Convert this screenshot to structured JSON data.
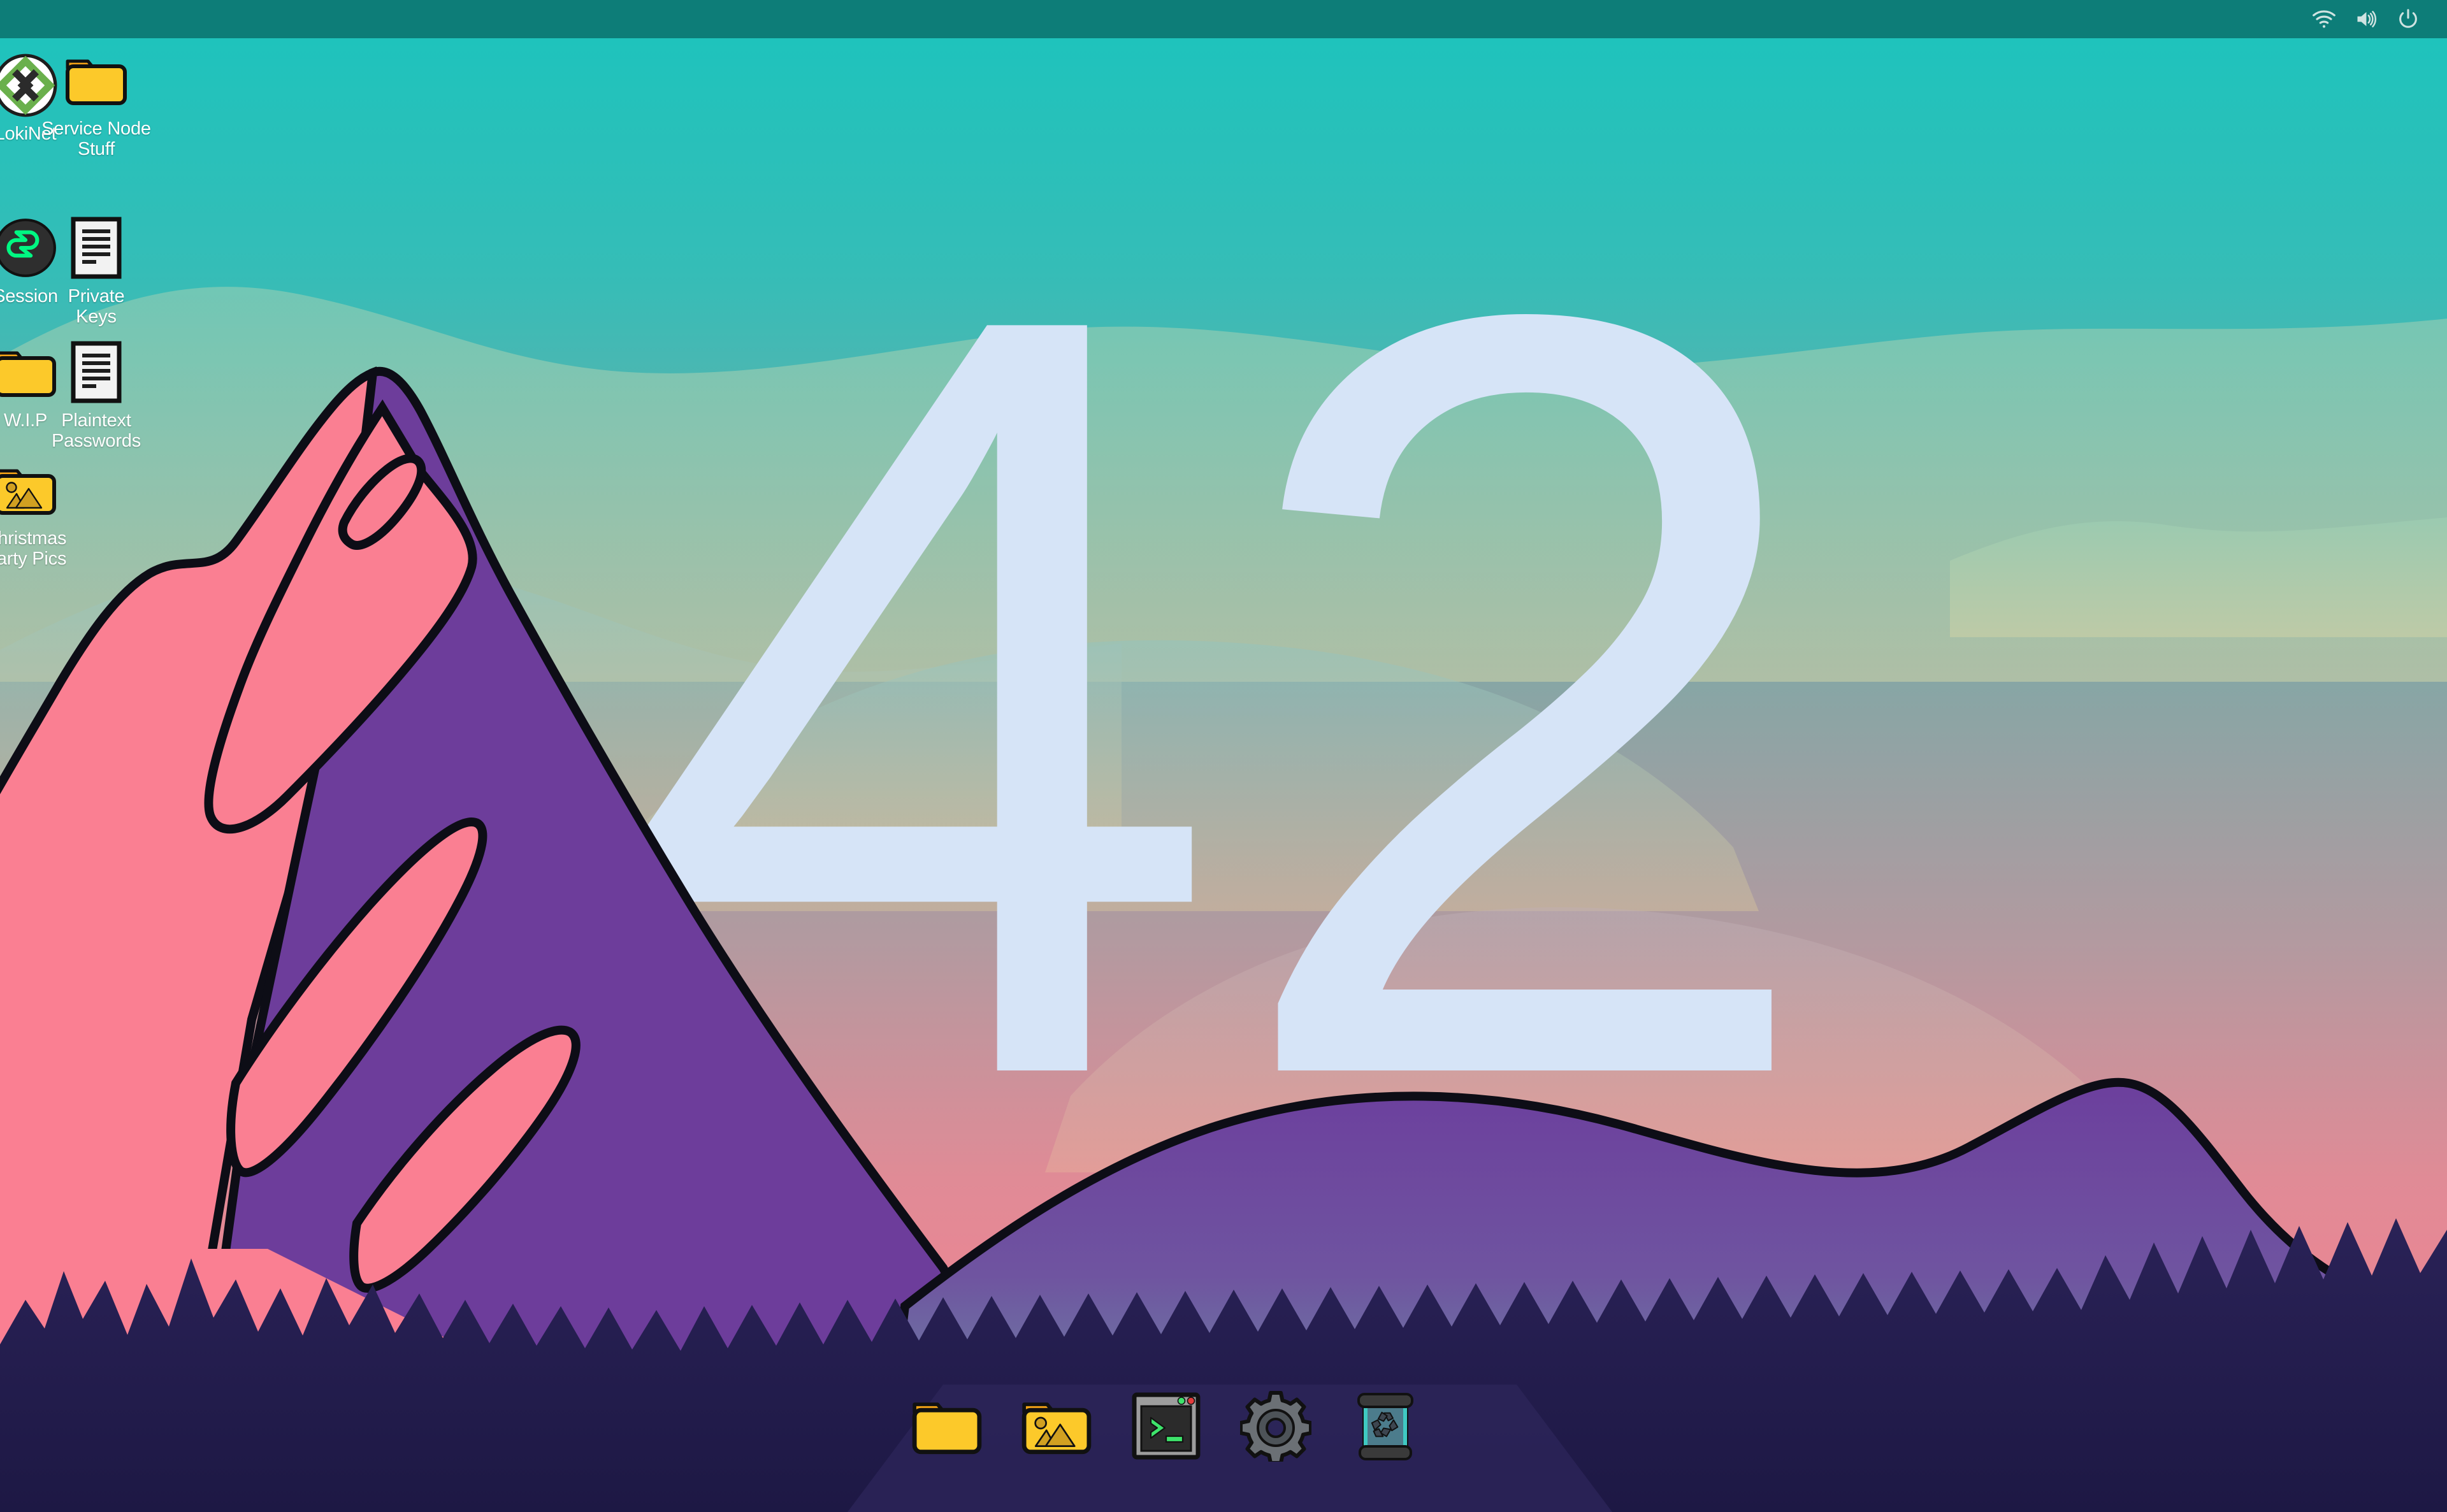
{
  "desktop": {
    "wallpaper": {
      "big_text": "42",
      "big_text_color": "#d6e4f7",
      "sky_top_color": "#1bc4bd",
      "sky_mid_color": "#8fa5a3",
      "sky_bottom_color": "#f07f8e",
      "mountain_pink_color": "#fa7f92",
      "mountain_purple_color": "#6e3e9c",
      "forest_color": "#231c4f",
      "outline_color": "#000000"
    },
    "icons": [
      {
        "label": "LokiNet",
        "icon": "lokinet-app-icon",
        "col": 0,
        "row": 0
      },
      {
        "label": "Service Node\nStuff",
        "icon": "folder-icon",
        "col": 1,
        "row": 0
      },
      {
        "label": "Session",
        "icon": "session-app-icon",
        "col": 0,
        "row": 1
      },
      {
        "label": "Private\nKeys",
        "icon": "text-document-icon",
        "col": 1,
        "row": 1
      },
      {
        "label": "W.I.P",
        "icon": "folder-icon",
        "col": 0,
        "row": 2
      },
      {
        "label": "Plaintext\nPasswords",
        "icon": "text-document-icon",
        "col": 1,
        "row": 2
      },
      {
        "label": "Christmas\nParty Pics",
        "icon": "folder-pictures-icon",
        "col": 0,
        "row": 3
      }
    ]
  },
  "topbar": {
    "background_color": "#0d7d78",
    "tray": [
      {
        "name": "wifi-icon",
        "title": "Network"
      },
      {
        "name": "volume-icon",
        "title": "Volume"
      },
      {
        "name": "power-icon",
        "title": "Power"
      }
    ]
  },
  "dock": {
    "background_color": "#2b2558",
    "items": [
      {
        "label": "Files",
        "icon": "folder-icon"
      },
      {
        "label": "Pictures",
        "icon": "folder-pictures-icon"
      },
      {
        "label": "Terminal",
        "icon": "terminal-icon"
      },
      {
        "label": "Settings",
        "icon": "gear-icon"
      },
      {
        "label": "Trash",
        "icon": "trash-icon"
      }
    ]
  }
}
